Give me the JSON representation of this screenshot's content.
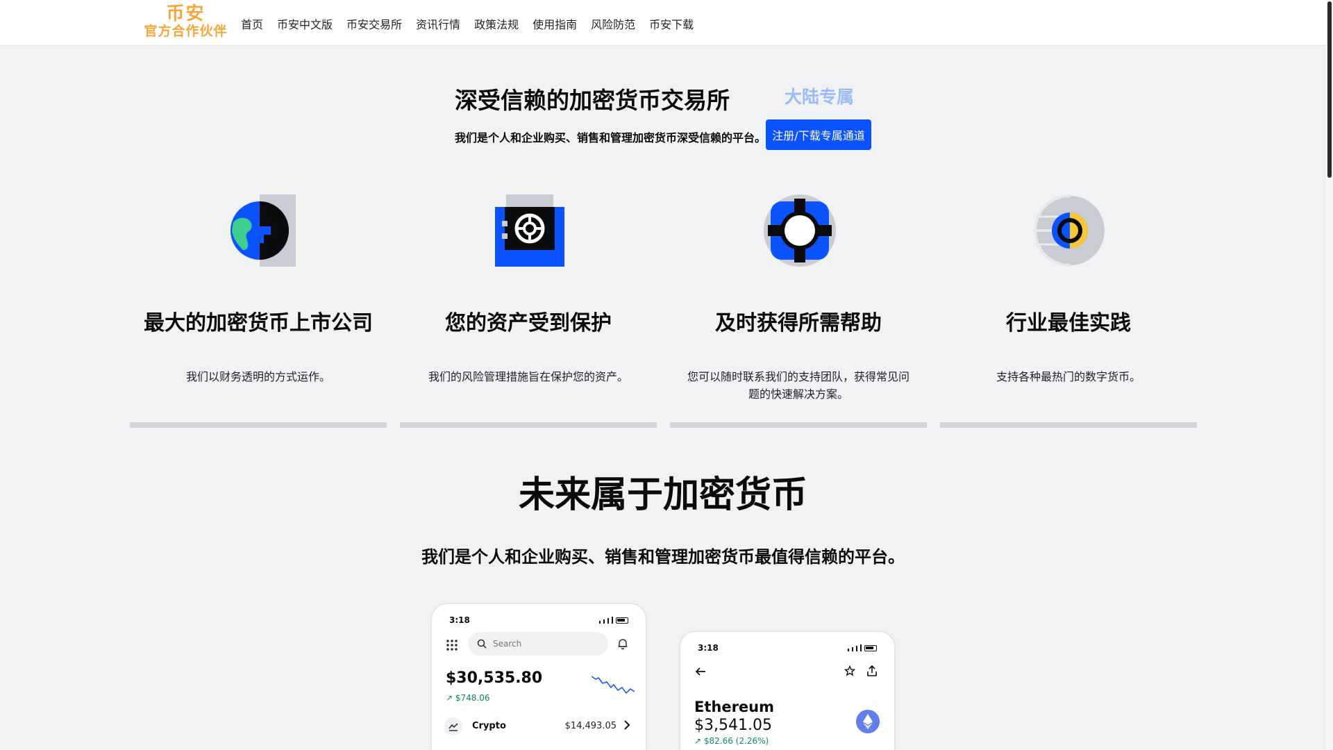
{
  "header": {
    "logo_line1": "币安",
    "logo_line2": "官方合作伙伴",
    "nav": [
      "首页",
      "币安中文版",
      "币安交易所",
      "资讯行情",
      "政策法规",
      "使用指南",
      "风险防范",
      "币安下载"
    ]
  },
  "hero": {
    "title": "深受信赖的加密货币交易所",
    "badge": "大陆专属",
    "subtitle": "我们是个人和企业购买、销售和管理加密货币深受信赖的平台。",
    "button_label": "注册/下载专属通道"
  },
  "features": [
    {
      "icon": "globe-icon",
      "title": "最大的加密货币上市公司",
      "desc": "我们以财务透明的方式运作。"
    },
    {
      "icon": "safe-icon",
      "title": "您的资产受到保护",
      "desc": "我们的风险管理措施旨在保护您的资产。"
    },
    {
      "icon": "lifebuoy-icon",
      "title": "及时获得所需帮助",
      "desc": "您可以随时联系我们的支持团队，获得常见问题的快速解决方案。"
    },
    {
      "icon": "coin-icon",
      "title": "行业最佳实践",
      "desc": "支持各种最热门的数字货币。"
    }
  ],
  "future": {
    "title": "未来属于加密货币",
    "subtitle": "我们是个人和企业购买、销售和管理加密货币最值得信赖的平台。"
  },
  "phone1": {
    "time": "3:18",
    "search_placeholder": "Search",
    "balance": "$30,535.80",
    "change": "↗ $748.06",
    "row_label": "Crypto",
    "row_value": "$14,493.05"
  },
  "phone2": {
    "time": "3:18",
    "asset_name": "Ethereum",
    "price": "$3,541.05",
    "change": "↗ $82.66 (2.26%)"
  },
  "colors": {
    "brand_blue": "#0a53ff",
    "logo_orange": "#f7a63b",
    "badge_blue": "#9cbcf7",
    "positive_green": "#0f8a5f"
  }
}
